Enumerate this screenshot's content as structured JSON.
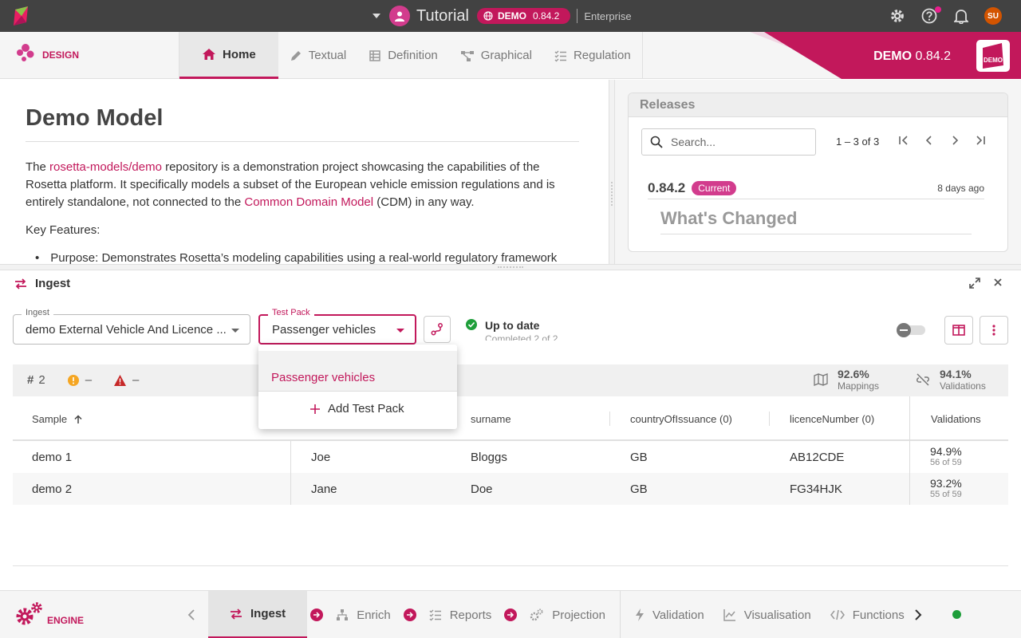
{
  "topbar": {
    "project_title": "Tutorial",
    "badge_label": "DEMO",
    "badge_version": "0.84.2",
    "edition": "Enterprise",
    "user_initials": "SU",
    "icons": [
      "app-logo-icon",
      "chevron-down-icon",
      "user-icon",
      "globe-icon",
      "gear-icon",
      "help-icon",
      "bell-icon"
    ]
  },
  "header": {
    "logo_label": "DESIGN",
    "tabs": [
      {
        "label": "Home",
        "icon": "home-icon",
        "active": true
      },
      {
        "label": "Textual",
        "icon": "pencil-icon"
      },
      {
        "label": "Definition",
        "icon": "table-icon"
      },
      {
        "label": "Graphical",
        "icon": "graph-icon"
      },
      {
        "label": "Regulation",
        "icon": "checklist-icon"
      }
    ],
    "banner_name": "DEMO",
    "banner_version": "0.84.2",
    "badge_text": "DEMO"
  },
  "doc": {
    "title": "Demo Model",
    "p_pre": "The ",
    "p_link1": "rosetta-models/demo",
    "p_mid": " repository is a demonstration project showcasing the capabilities of the Rosetta platform. It specifically models a subset of the European vehicle emission regulations and is entirely standalone, not connected to the ",
    "p_link2": "Common Domain Model",
    "p_post": " (CDM) in any way.",
    "key_features": "Key Features:",
    "bullet": "Purpose: Demonstrates Rosetta’s modeling capabilities using a real-world regulatory framework"
  },
  "releases": {
    "title": "Releases",
    "search_placeholder": "Search...",
    "range": "1 – 3 of 3",
    "version": "0.84.2",
    "current_label": "Current",
    "age": "8 days ago",
    "whats_changed": "What's Changed"
  },
  "ingest": {
    "title": "Ingest",
    "ingest_field_label": "Ingest",
    "ingest_value": "demo External Vehicle And Licence ...",
    "testpack_label": "Test Pack",
    "testpack_value": "Passenger vehicles",
    "status_title": "Up to date",
    "status_sub": "Completed 2 of 2",
    "count": "2",
    "warnings": "–",
    "errors": "–",
    "mappings_pct": "92.6%",
    "mappings_label": "Mappings",
    "validations_pct": "94.1%",
    "validations_label": "Validations"
  },
  "table": {
    "columns": [
      "Sample",
      "surname",
      "countryOfIssuance (0)",
      "licenceNumber (0)",
      "Validations"
    ],
    "rows": [
      {
        "sample": "demo 1",
        "first": "Joe",
        "surname": "Bloggs",
        "country": "GB",
        "licence": "AB12CDE",
        "pct": "94.9%",
        "frac": "56 of 59"
      },
      {
        "sample": "demo 2",
        "first": "Jane",
        "surname": "Doe",
        "country": "GB",
        "licence": "FG34HJK",
        "pct": "93.2%",
        "frac": "55 of 59"
      }
    ]
  },
  "dropdown": {
    "option": "Passenger vehicles",
    "add_label": "Add Test Pack"
  },
  "footer": {
    "logo_label": "ENGINE",
    "tabs": [
      {
        "label": "Ingest",
        "icon": "swap-icon",
        "active": true
      },
      {
        "label": "Enrich",
        "icon": "hierarchy-icon"
      },
      {
        "label": "Reports",
        "icon": "checklist-icon"
      },
      {
        "label": "Projection",
        "icon": "gears-icon"
      },
      {
        "label": "Validation",
        "icon": "bolt-icon"
      },
      {
        "label": "Visualisation",
        "icon": "line-chart-icon"
      },
      {
        "label": "Functions",
        "icon": "code-icon"
      }
    ]
  },
  "colors": {
    "accent": "#c2185b",
    "topbar": "#424242",
    "status_ok": "#1e9e3a"
  }
}
